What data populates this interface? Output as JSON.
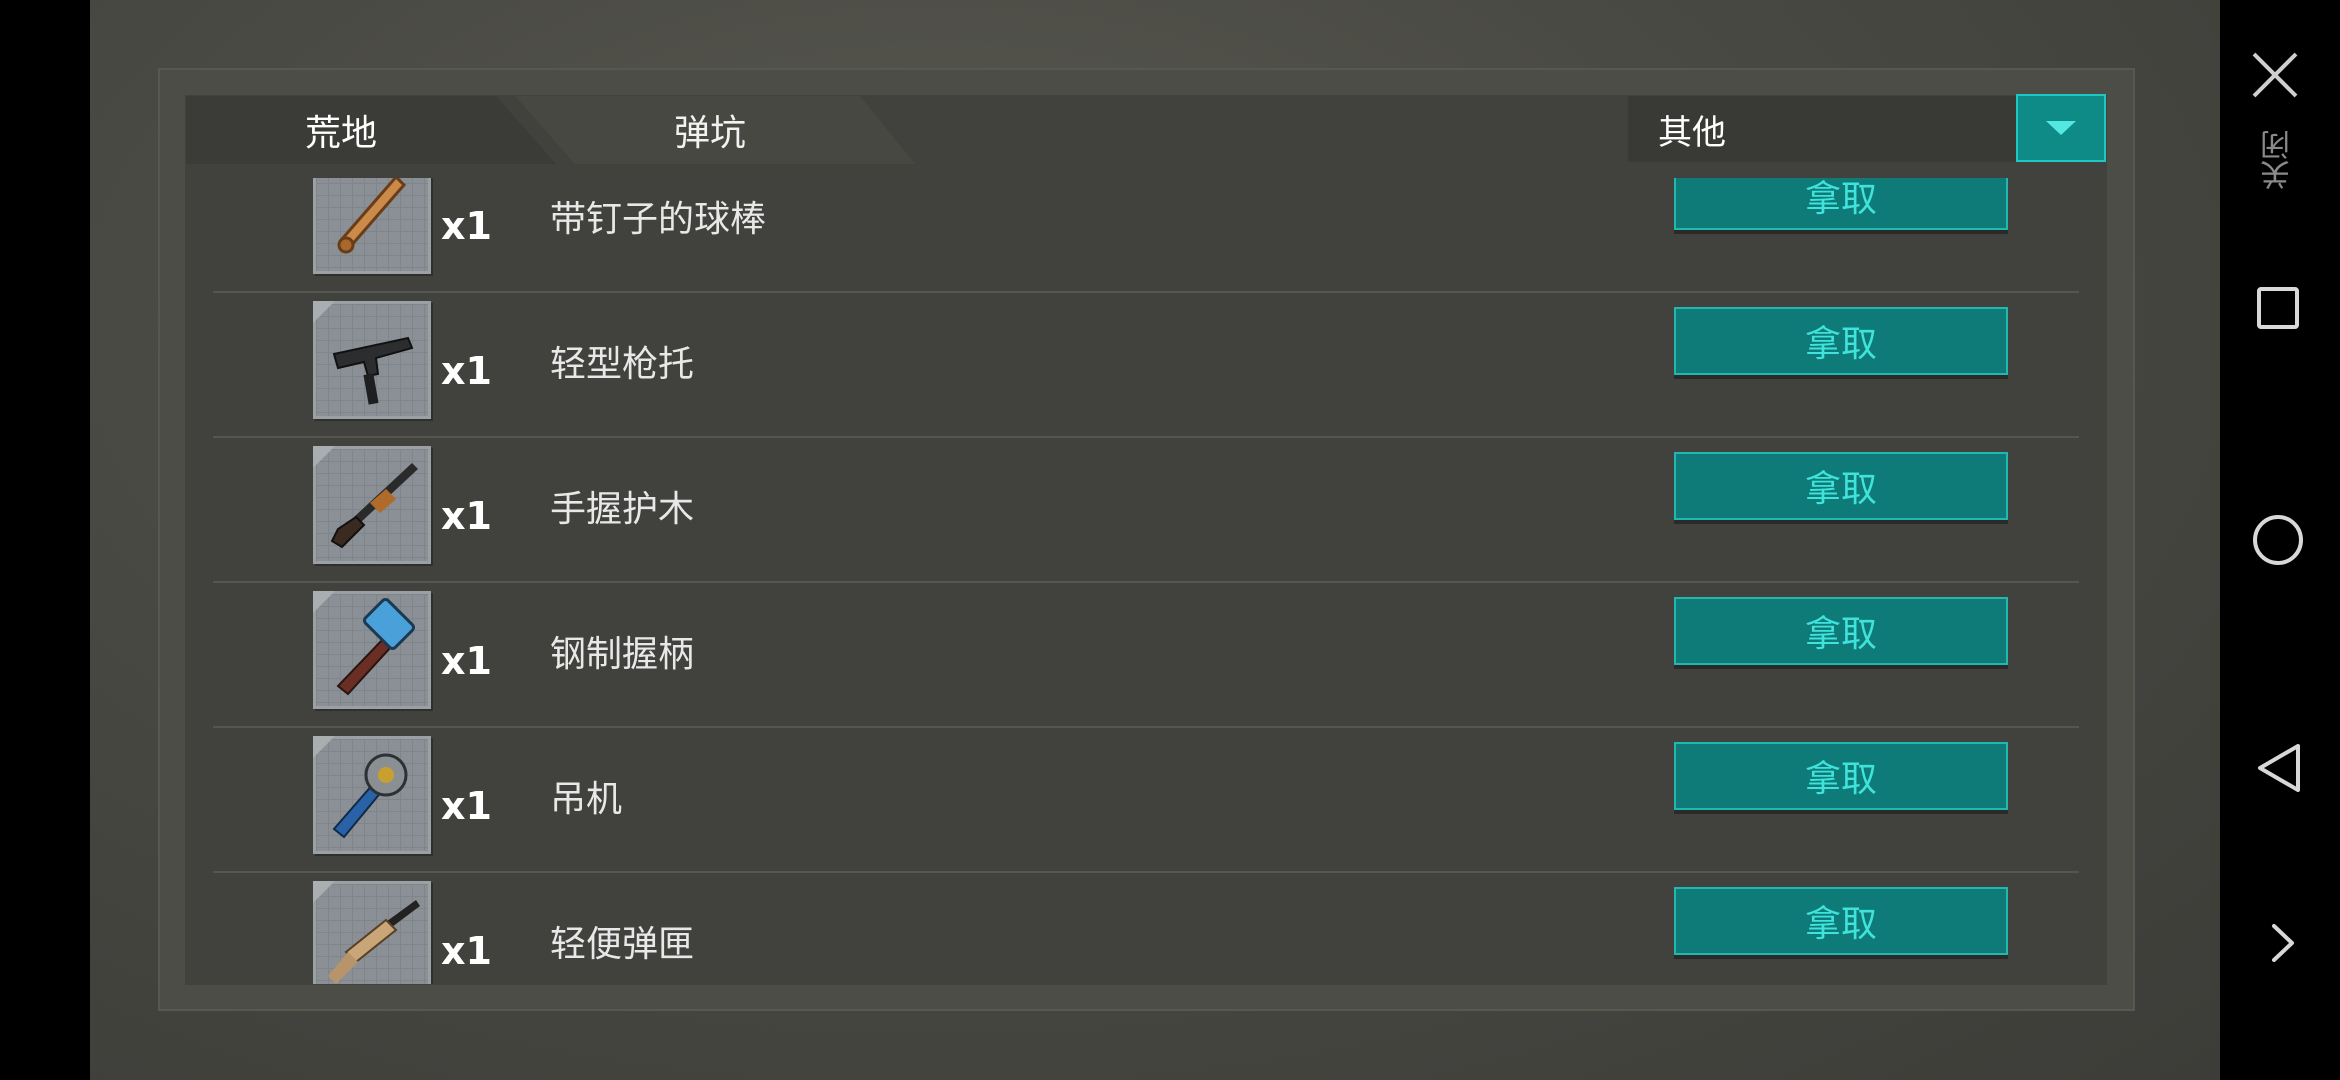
{
  "tabs": [
    {
      "label": "荒地"
    },
    {
      "label": "弹坑"
    }
  ],
  "filter": {
    "selected": "其他"
  },
  "items": [
    {
      "name": "带钉子的球棒",
      "qty": "x1",
      "action": "拿取",
      "icon": "baseball-bat-icon"
    },
    {
      "name": "轻型枪托",
      "qty": "x1",
      "action": "拿取",
      "icon": "submachine-gun-icon"
    },
    {
      "name": "手握护木",
      "qty": "x1",
      "action": "拿取",
      "icon": "shotgun-icon"
    },
    {
      "name": "钢制握柄",
      "qty": "x1",
      "action": "拿取",
      "icon": "sledgehammer-icon"
    },
    {
      "name": "吊机",
      "qty": "x1",
      "action": "拿取",
      "icon": "spiked-mace-icon"
    },
    {
      "name": "轻便弹匣",
      "qty": "x1",
      "action": "拿取",
      "icon": "assault-rifle-icon"
    }
  ],
  "navbar": {
    "close_label": "关闭"
  },
  "colors": {
    "accent": "#0e7b78",
    "accent_text": "#3fe3dc",
    "panel": "#41423e"
  }
}
